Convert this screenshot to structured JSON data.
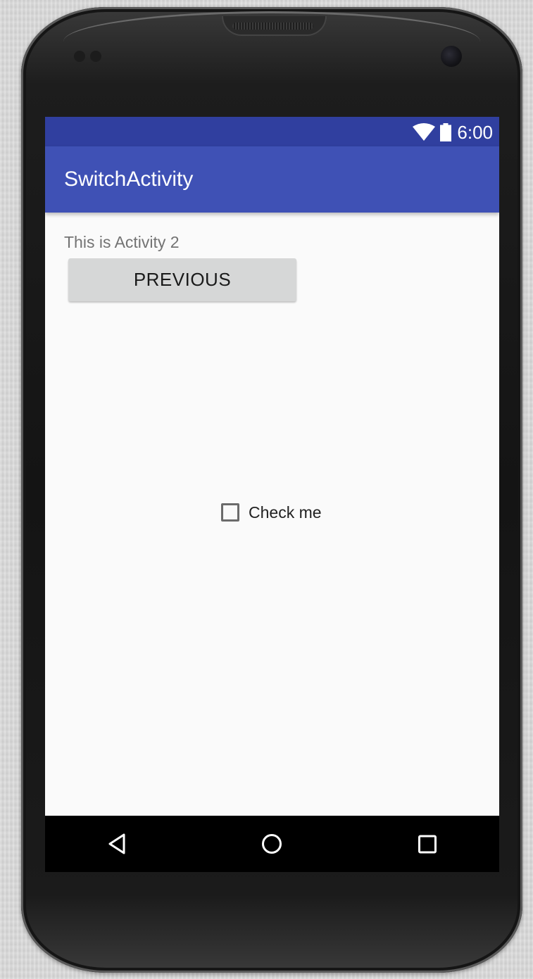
{
  "status_bar": {
    "time": "6:00",
    "icons": [
      "wifi-icon",
      "battery-icon"
    ],
    "background": "#303f9f"
  },
  "app_bar": {
    "title": "SwitchActivity",
    "background": "#3f51b5"
  },
  "content": {
    "activity_text": "This is Activity 2",
    "previous_button_label": "PREVIOUS",
    "checkbox": {
      "label": "Check me",
      "checked": false
    }
  },
  "navigation_bar": {
    "buttons": [
      "back-icon",
      "home-icon",
      "recent-apps-icon"
    ]
  }
}
